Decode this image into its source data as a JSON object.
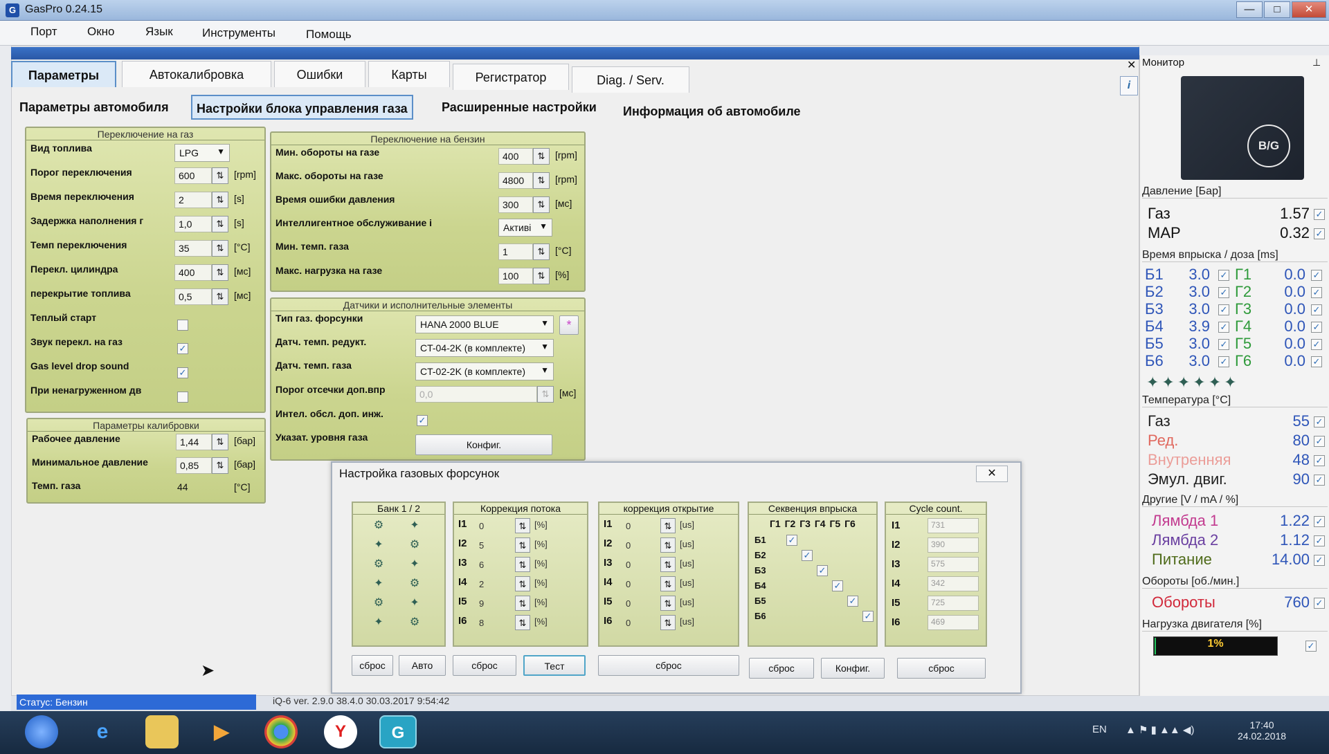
{
  "window": {
    "title": "GasPro 0.24.15",
    "app_icon": "G",
    "controls": {
      "minimize": "—",
      "maximize": "□",
      "close": "✕"
    }
  },
  "menu": [
    "Порт",
    "Окно",
    "Язык",
    "Инструменты",
    "Помощь"
  ],
  "tabs": [
    "Параметры",
    "Автокалибровка",
    "Ошибки",
    "Карты",
    "Регистратор",
    "Diag. / Serv."
  ],
  "subtabs": [
    "Параметры автомобиля",
    "Настройки блока управления газа",
    "Расширенные настройки",
    "Информация об автомобиле"
  ],
  "panel_close": "✕",
  "help_button": "i",
  "switch_gas": {
    "title": "Переключение на газ",
    "rows": [
      {
        "label": "Вид топлива",
        "value": "LPG",
        "type": "combo"
      },
      {
        "label": "Порог переключения",
        "value": "600",
        "unit": "[rpm]",
        "type": "spin"
      },
      {
        "label": "Время переключения",
        "value": "2",
        "unit": "[s]",
        "type": "spin"
      },
      {
        "label": "Задержка наполнения г",
        "value": "1,0",
        "unit": "[s]",
        "type": "spin"
      },
      {
        "label": "Темп переключения",
        "value": "35",
        "unit": "[°C]",
        "type": "spin"
      },
      {
        "label": "Перекл. цилиндра",
        "value": "400",
        "unit": "[мс]",
        "type": "spin"
      },
      {
        "label": "перекрытие топлива",
        "value": "0,5",
        "unit": "[мс]",
        "type": "spin"
      },
      {
        "label": "Теплый старт",
        "checked": "",
        "type": "check"
      },
      {
        "label": "Звук перекл. на газ",
        "checked": "✓",
        "type": "check"
      },
      {
        "label": "Gas level drop sound",
        "checked": "✓",
        "type": "check"
      },
      {
        "label": "При ненагруженном дв",
        "checked": "",
        "type": "check"
      }
    ]
  },
  "calibration": {
    "title": "Параметры калибровки",
    "rows": [
      {
        "label": "Рабочее давление",
        "value": "1,44",
        "unit": "[бар]"
      },
      {
        "label": "Минимальное давление",
        "value": "0,85",
        "unit": "[бар]"
      },
      {
        "label": "Темп. газа",
        "value": "44",
        "unit": "[°C]"
      }
    ]
  },
  "switch_petrol": {
    "title": "Переключение на бензин",
    "rows": [
      {
        "label": "Мин. обороты на газе",
        "value": "400",
        "unit": "[rpm]"
      },
      {
        "label": "Макс. обороты на газе",
        "value": "4800",
        "unit": "[rpm]"
      },
      {
        "label": "Время ошибки давления",
        "value": "300",
        "unit": "[мс]"
      },
      {
        "label": "Интеллигентное обслуживание і",
        "value": "Активі",
        "unit": ""
      },
      {
        "label": "Мин. темп. газа",
        "value": "1",
        "unit": "[°C]"
      },
      {
        "label": "Макс. нагрузка на газе",
        "value": "100",
        "unit": "[%]"
      }
    ]
  },
  "sensors": {
    "title": "Датчики и исполнительные элементы",
    "rows": [
      {
        "label": "Тип газ. форсунки",
        "value": "HANA 2000 BLUE"
      },
      {
        "label": "Датч. темп. редукт.",
        "value": "CT-04-2K (в комплекте)"
      },
      {
        "label": "Датч. темп. газа",
        "value": "CT-02-2K (в комплекте)"
      },
      {
        "label": "Порог отсечки доп.впр",
        "value": "0,0",
        "unit": "[мс]"
      },
      {
        "label": "Интел. обсл. доп. инж.",
        "checked": "✓"
      },
      {
        "label": "Указат. уровня газа",
        "button": "Конфиг."
      }
    ],
    "star": "*"
  },
  "dialog": {
    "title": "Настройка газовых форсунок",
    "close": "✕",
    "bank_title": "Банк 1 / 2",
    "flow_title": "Коррекция потока",
    "open_title": "коррекция открытие",
    "seq_title": "Секвенция впрыска",
    "cycle_title": "Cycle count.",
    "rows": [
      "I1",
      "I2",
      "I3",
      "I4",
      "I5",
      "I6"
    ],
    "flow_values": [
      "0",
      "5",
      "6",
      "2",
      "9",
      "8"
    ],
    "flow_unit": "[%]",
    "open_values": [
      "0",
      "0",
      "0",
      "0",
      "0",
      "0"
    ],
    "open_unit": "[us]",
    "seq_cols": [
      "Г1",
      "Г2",
      "Г3",
      "Г4",
      "Г5",
      "Г6"
    ],
    "seq_rows": [
      "Б1",
      "Б2",
      "Б3",
      "Б4",
      "Б5",
      "Б6"
    ],
    "cycle_values": [
      "731",
      "390",
      "575",
      "342",
      "725",
      "469"
    ],
    "buttons": [
      "сброс",
      "Авто",
      "сброс",
      "Тест",
      "сброс",
      "сброс",
      "Конфиг.",
      "сброс"
    ]
  },
  "monitor": {
    "title": "Монитор",
    "pin": "⊥",
    "logo": "B/G",
    "pressure_title": "Давление [Бар]",
    "pressure": [
      {
        "name": "Газ",
        "value": "1.57"
      },
      {
        "name": "MAP",
        "value": "0.32"
      }
    ],
    "injection_title": "Время впрыска / доза [ms]",
    "injection": [
      {
        "b": "Б1",
        "bv": "3.0",
        "g": "Г1",
        "gv": "0.0"
      },
      {
        "b": "Б2",
        "bv": "3.0",
        "g": "Г2",
        "gv": "0.0"
      },
      {
        "b": "Б3",
        "bv": "3.0",
        "g": "Г3",
        "gv": "0.0"
      },
      {
        "b": "Б4",
        "bv": "3.9",
        "g": "Г4",
        "gv": "0.0"
      },
      {
        "b": "Б5",
        "bv": "3.0",
        "g": "Г5",
        "gv": "0.0"
      },
      {
        "b": "Б6",
        "bv": "3.0",
        "g": "Г6",
        "gv": "0.0"
      }
    ],
    "temp_title": "Температура [°C]",
    "temps": [
      {
        "name": "Газ",
        "value": "55",
        "color": "#222222"
      },
      {
        "name": "Ред.",
        "value": "80",
        "color": "#e0685e"
      },
      {
        "name": "Внутренняя",
        "value": "48",
        "color": "#eb9d98"
      },
      {
        "name": "Эмул. двиг.",
        "value": "90",
        "color": "#222222"
      }
    ],
    "other_title": "Другие [V / mA / %]",
    "others": [
      {
        "name": "Лямбда 1",
        "value": "1.22",
        "color": "#c23a8f"
      },
      {
        "name": "Лямбда 2",
        "value": "1.12",
        "color": "#6a3fa0"
      },
      {
        "name": "Питание",
        "value": "14.00",
        "color": "#4f6b1a"
      }
    ],
    "rpm_title": "Обороты [об./мин.]",
    "rpm": {
      "name": "Обороты",
      "value": "760",
      "color": "#d1283a"
    },
    "load_title": "Нагрузка двигателя [%]",
    "load": {
      "text": "1%",
      "fraction": 0.01
    }
  },
  "status": {
    "label": "Статус: Бензин",
    "version": "iQ-6  ver. 2.9.0  38.4.0  30.03.2017 9:54:42"
  },
  "taskbar": {
    "lang": "EN",
    "time": "17:40",
    "date": "24.02.2018"
  }
}
